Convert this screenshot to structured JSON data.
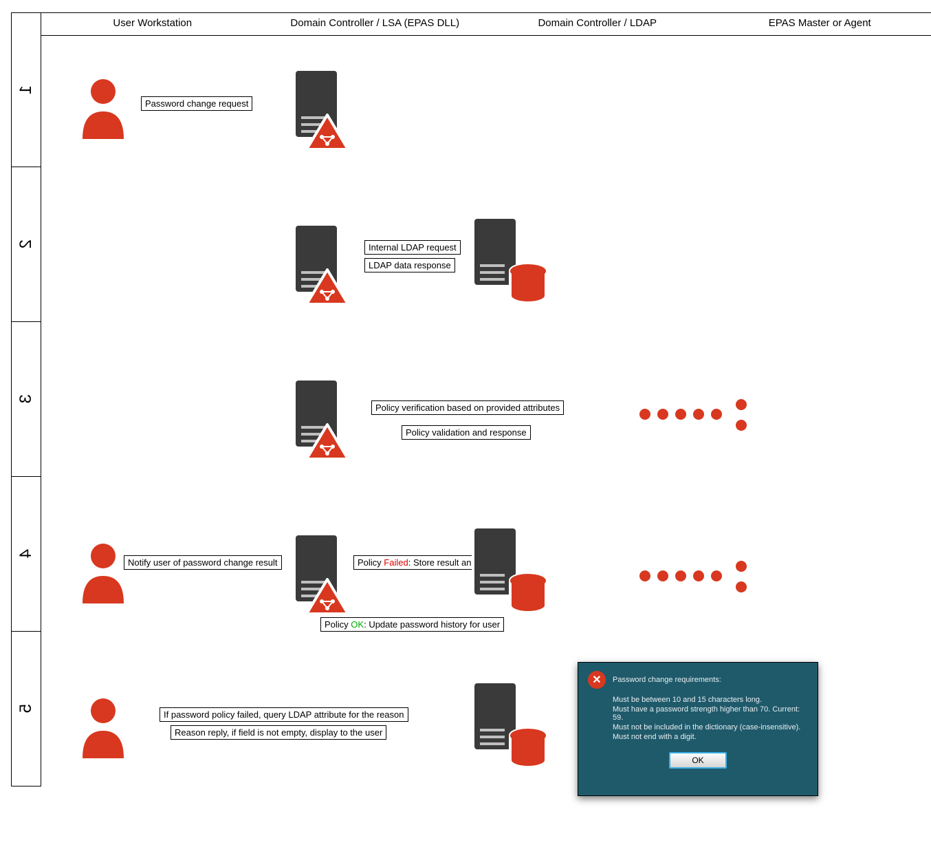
{
  "columns": [
    "User Workstation",
    "Domain Controller / LSA (EPAS DLL)",
    "Domain Controller / LDAP",
    "EPAS Master or Agent"
  ],
  "steps": [
    "1",
    "2",
    "3",
    "4",
    "5"
  ],
  "row1": {
    "msg": "Password change request"
  },
  "row2": {
    "msg1": "Internal LDAP request",
    "msg2": "LDAP data response"
  },
  "row3": {
    "msg1": "Policy verification based on provided attributes",
    "msg2": "Policy validation and response"
  },
  "row4": {
    "notify": "Notify user of password change result",
    "fail_pre": "Policy ",
    "fail_word": "Failed",
    "fail_post": ": Store result and reason",
    "ok_pre": "Policy ",
    "ok_word": "OK",
    "ok_post": ": Update password history for user"
  },
  "row5": {
    "q1": "If password policy failed, query LDAP attribute for the reason",
    "q2": "Reason reply, if field is not empty, display to the user"
  },
  "dialog": {
    "title": "Password change requirements:",
    "l1": "Must be between 10 and 15 characters long.",
    "l2": "Must have a password strength higher than 70. Current: 59.",
    "l3": "Must not be included in the dictionary (case-insensitive).",
    "l4": "Must not end with a digit.",
    "ok": "OK"
  }
}
